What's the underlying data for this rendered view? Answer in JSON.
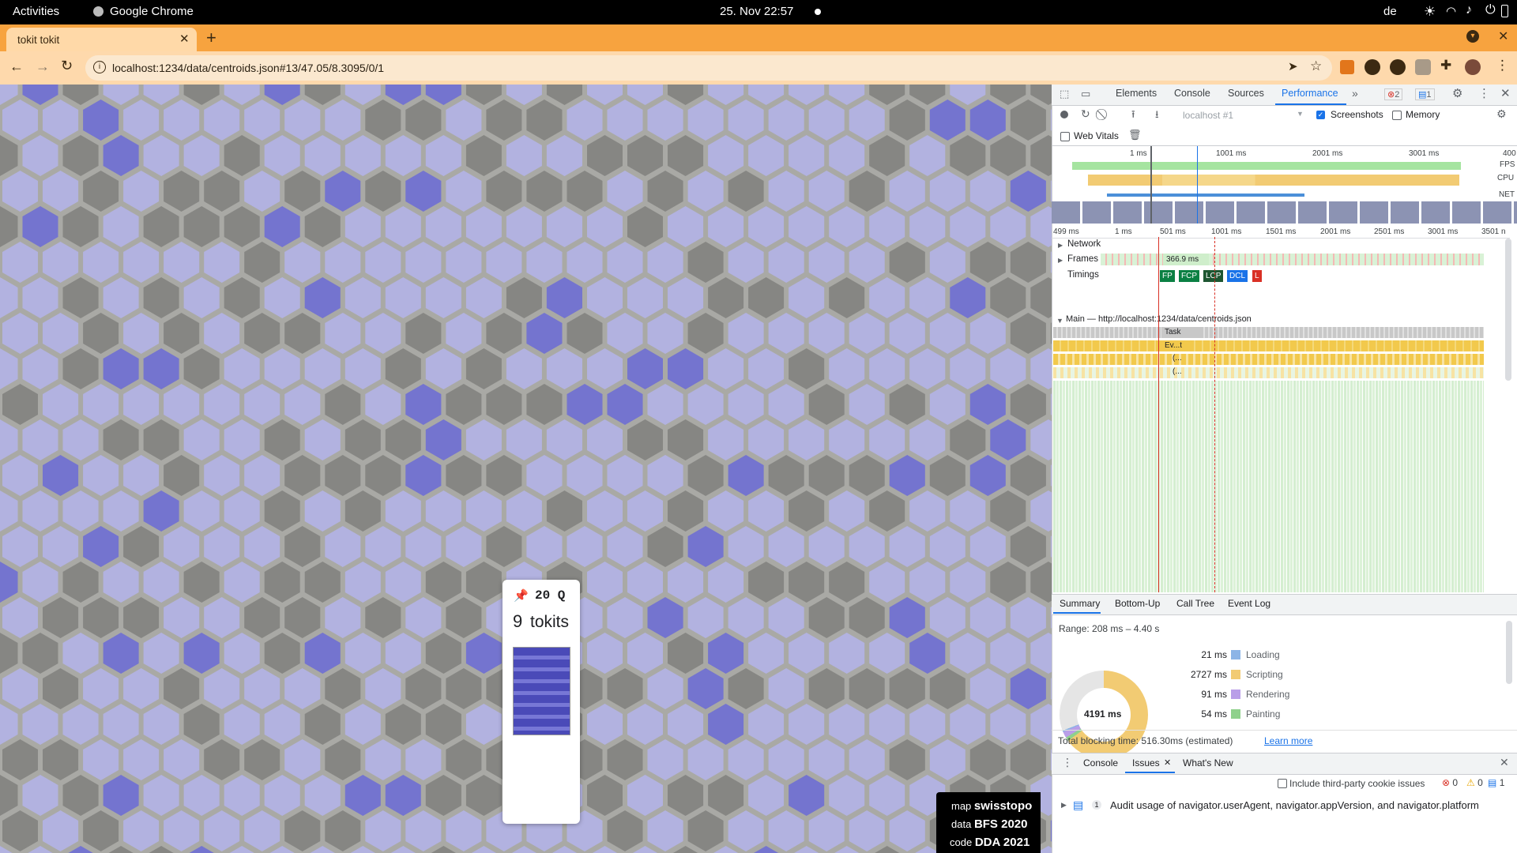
{
  "os_bar": {
    "activities": "Activities",
    "app_name": "Google Chrome",
    "clock": "25. Nov  22:57",
    "keyboard_layout": "de"
  },
  "browser": {
    "tab_title": "tokit tokit",
    "url": "localhost:1234/data/centroids.json#13/47.05/8.3095/0/1"
  },
  "map": {
    "popup": {
      "pin_icon": "pushpin-icon",
      "count_line": "20 Q",
      "tokits_number": "9",
      "tokits_label": "tokits"
    },
    "attribution": [
      {
        "prefix": "map",
        "value": "swisstopo"
      },
      {
        "prefix": "data",
        "value": "BFS 2020"
      },
      {
        "prefix": "code",
        "value": "DDA 2021"
      }
    ],
    "colors": {
      "hex_fill": "#b4b4ea",
      "hex_dark": "#7b7b78",
      "background": "#a9a9a5",
      "accent_blue": "#6b6bd6"
    }
  },
  "devtools": {
    "tabs": [
      "Elements",
      "Console",
      "Sources",
      "Performance"
    ],
    "active_tab": "Performance",
    "error_count": "2",
    "message_count": "1",
    "perf_toolbar": {
      "target": "localhost #1",
      "screenshots_label": "Screenshots",
      "memory_label": "Memory",
      "web_vitals_label": "Web Vitals"
    },
    "overview": {
      "ruler": [
        "1 ms",
        "1001 ms",
        "2001 ms",
        "3001 ms",
        "400"
      ],
      "lane_labels": [
        "FPS",
        "CPU",
        "NET"
      ]
    },
    "timeline_ruler": [
      "499 ms",
      "1 ms",
      "501 ms",
      "1001 ms",
      "1501 ms",
      "2001 ms",
      "2501 ms",
      "3001 ms",
      "3501 n"
    ],
    "tracks": {
      "network": "Network",
      "frames": "Frames",
      "frame_value": "366.9 ms",
      "timings": "Timings",
      "timing_badges": [
        "FP",
        "FCP",
        "LCP",
        "DCL",
        "L"
      ],
      "main": "Main — http://localhost:1234/data/centroids.json",
      "task_label": "Task",
      "event_label": "Ev...t",
      "sub_labels": [
        "(...",
        "(..."
      ]
    },
    "bottom_tabs": [
      "Summary",
      "Bottom-Up",
      "Call Tree",
      "Event Log"
    ],
    "summary": {
      "range": "Range: 208 ms – 4.40 s",
      "total": "4191 ms",
      "rows": [
        {
          "value": "21 ms",
          "label": "Loading",
          "color": "#8cb4e6"
        },
        {
          "value": "2727 ms",
          "label": "Scripting",
          "color": "#f2cb73"
        },
        {
          "value": "91 ms",
          "label": "Rendering",
          "color": "#b99ee8"
        },
        {
          "value": "54 ms",
          "label": "Painting",
          "color": "#8fd18c"
        }
      ],
      "blocking": "Total blocking time: 516.30ms (estimated)",
      "learn_more": "Learn more"
    },
    "drawer": {
      "tabs": [
        "Console",
        "Issues",
        "What's New"
      ],
      "active": "Issues",
      "third_party_label": "Include third-party cookie issues",
      "counts": {
        "errors": "0",
        "warnings": "0",
        "info": "1"
      },
      "issue_count": "1",
      "issue_text": "Audit usage of navigator.userAgent, navigator.appVersion, and navigator.platform"
    }
  }
}
